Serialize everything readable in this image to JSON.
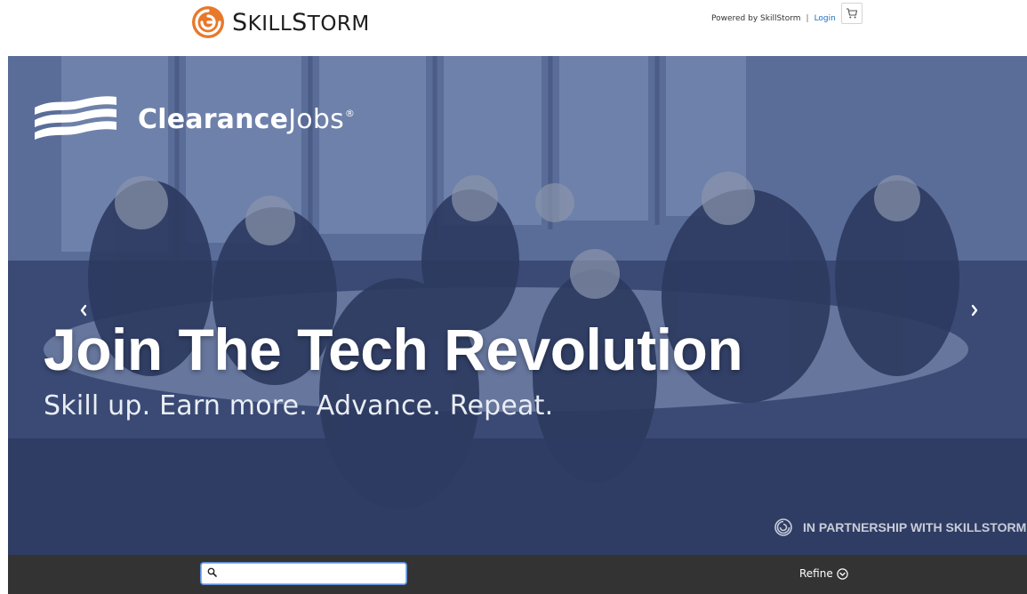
{
  "header": {
    "brand_prefix": "S",
    "brand_rest": "KILL",
    "brand_prefix2": "S",
    "brand_rest2": "TORM",
    "powered_by": "Powered by SkillStorm",
    "separator": "|",
    "login_label": "Login",
    "cart_icon": "cart-icon",
    "logo_color": "#e8782a"
  },
  "hero": {
    "partner_name_bold": "Clearance",
    "partner_name_light": "Jobs",
    "partner_mark": "®",
    "title": "Join The Tech Revolution",
    "subtitle": "Skill up. Earn more. Advance. Repeat.",
    "partnership": "IN PARTNERSHIP WITH SKILLSTORM",
    "prev_icon": "chevron-left-icon",
    "next_icon": "chevron-right-icon",
    "overlay_color": "#2a3a64"
  },
  "toolbar": {
    "search_placeholder": "",
    "search_value": "",
    "refine_label": "Refine",
    "refine_icon": "chevron-circle-down-icon",
    "bar_color": "#333333"
  }
}
